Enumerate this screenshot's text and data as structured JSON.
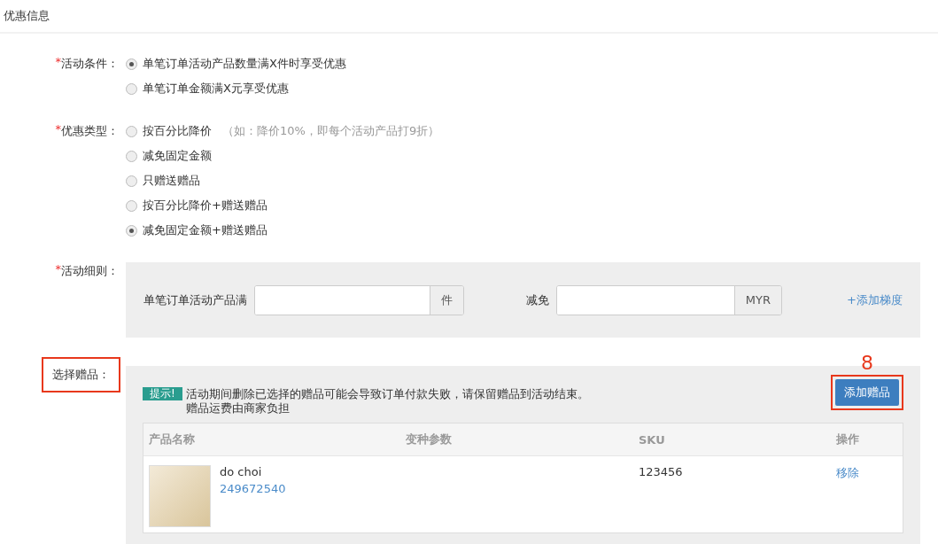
{
  "section_title": "优惠信息",
  "condition": {
    "label": "活动条件：",
    "required_mark": "*",
    "options": [
      {
        "label": "单笔订单活动产品数量满X件时享受优惠",
        "selected": true
      },
      {
        "label": "单笔订单金额满X元享受优惠",
        "selected": false
      }
    ]
  },
  "discount_type": {
    "label": "优惠类型：",
    "required_mark": "*",
    "options": [
      {
        "label": "按百分比降价",
        "hint": "（如：降价10%，即每个活动产品打9折）",
        "selected": false
      },
      {
        "label": "减免固定金额",
        "selected": false
      },
      {
        "label": "只赠送赠品",
        "selected": false
      },
      {
        "label": "按百分比降价+赠送赠品",
        "selected": false
      },
      {
        "label": "减免固定金额+赠送赠品",
        "selected": true
      }
    ]
  },
  "rules": {
    "label": "活动细则：",
    "required_mark": "*",
    "quantity_label": "单笔订单活动产品满",
    "quantity_unit": "件",
    "reduce_label": "减免",
    "reduce_unit": "MYR",
    "add_tier": "+添加梯度"
  },
  "gifts": {
    "label": "选择赠品：",
    "label_highlighted": true,
    "tip_badge": "提示!",
    "tip_lines": [
      "活动期间删除已选择的赠品可能会导致订单付款失败，请保留赠品到活动结束。",
      "赠品运费由商家负担"
    ],
    "annotation": "8",
    "add_button": "添加赠品",
    "add_button_highlighted": true,
    "table": {
      "columns": [
        "产品名称",
        "变种参数",
        "SKU",
        "操作"
      ],
      "rows": [
        {
          "name": "do choi",
          "id": "249672540",
          "sku": "123456",
          "action": "移除"
        }
      ]
    }
  }
}
